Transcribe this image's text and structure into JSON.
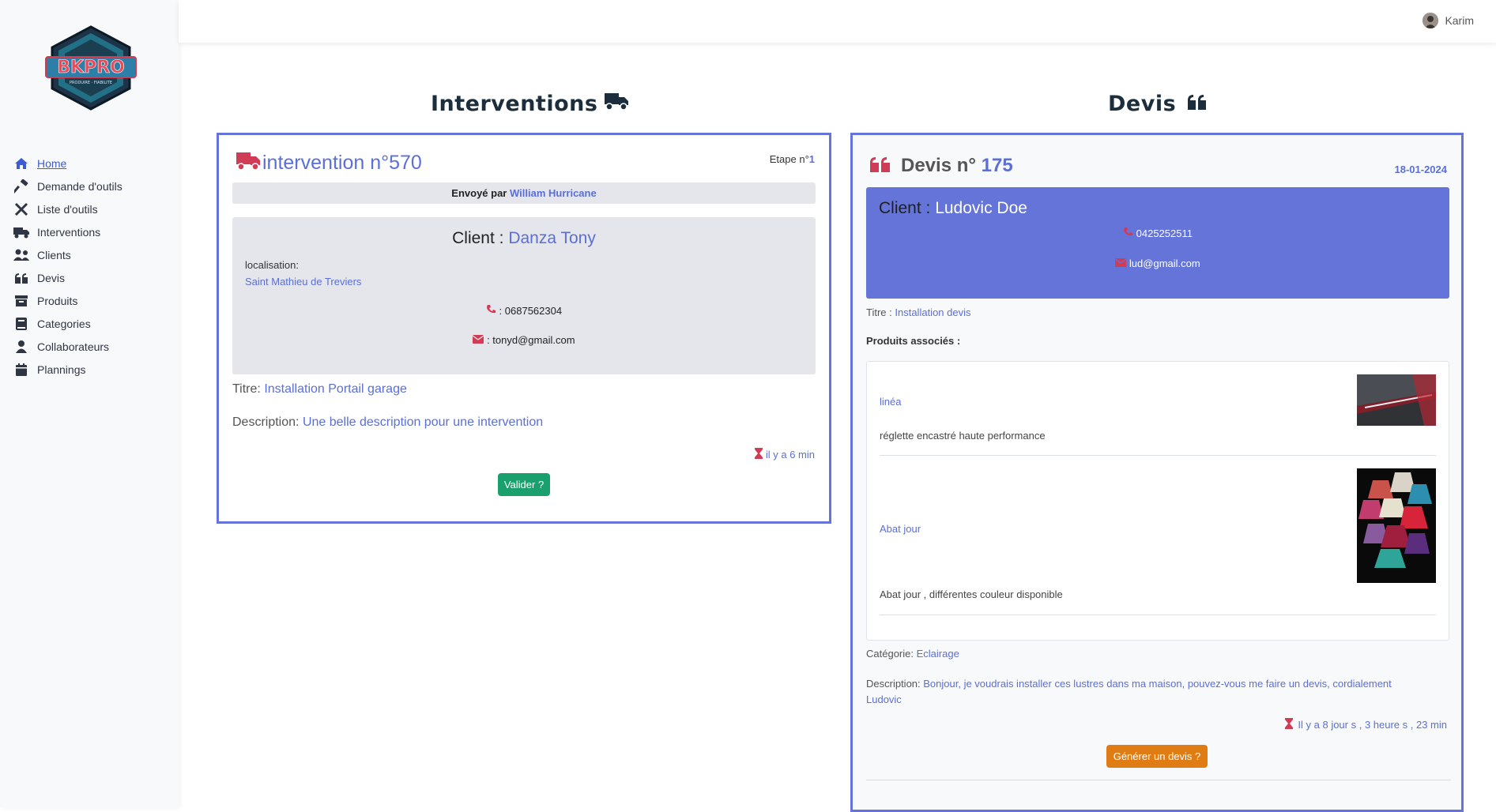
{
  "user": {
    "name": "Karim"
  },
  "brand": {
    "logo_text": "BKPRO",
    "logo_tagline": "PRODUIRE · FIABILITE"
  },
  "sidebar": {
    "items": [
      {
        "label": "Home",
        "icon": "home-icon"
      },
      {
        "label": "Demande d'outils",
        "icon": "hammer-icon"
      },
      {
        "label": "Liste d'outils",
        "icon": "tools-icon"
      },
      {
        "label": "Interventions",
        "icon": "truck-icon"
      },
      {
        "label": "Clients",
        "icon": "users-icon"
      },
      {
        "label": "Devis",
        "icon": "quote-icon"
      },
      {
        "label": "Produits",
        "icon": "box-icon"
      },
      {
        "label": "Categories",
        "icon": "book-icon"
      },
      {
        "label": "Collaborateurs",
        "icon": "user-icon"
      },
      {
        "label": "Plannings",
        "icon": "calendar-icon"
      }
    ]
  },
  "interventions": {
    "section_title": "Interventions",
    "title_prefix": "intervention n°",
    "number": "570",
    "etape_label": "Etape n°",
    "etape_value": "1",
    "sent_by_label": "Envoyé par",
    "sent_by": "William Hurricane",
    "client_label": "Client :",
    "client_name": "Danza Tony",
    "localisation_label": "localisation:",
    "localisation": "Saint Mathieu de Treviers",
    "phone": ": 0687562304",
    "email": ": tonyd@gmail.com",
    "titre_label": "Titre:",
    "titre": "Installation Portail garage",
    "description_label": "Description:",
    "description": "Une belle description pour une intervention",
    "time": "il y a 6 min",
    "validate_label": "Valider ?"
  },
  "devis": {
    "section_title": "Devis",
    "title_prefix": "Devis n°",
    "number": "175",
    "date": "18-01-2024",
    "client_label": "Client :",
    "client_name": "Ludovic Doe",
    "phone": "0425252511",
    "email": "lud@gmail.com",
    "titre_label": "Titre :",
    "titre": "Installation devis",
    "produits_label": "Produits associés :",
    "produits": [
      {
        "name": "linéa",
        "description": "réglette encastré haute performance"
      },
      {
        "name": "Abat jour",
        "description": "Abat jour , différentes couleur disponible"
      }
    ],
    "categorie_label": "Catégorie:",
    "categorie": "Eclairage",
    "description_label": "Description:",
    "description_line1": "Bonjour, je voudrais installer ces lustres dans ma maison, pouvez-vous me faire un devis, cordialement",
    "description_line2": "Ludovic",
    "time": "Il y a 8 jour s , 3 heure s , 23 min",
    "generate_label": "Générer un devis ?"
  },
  "colors": {
    "accent": "#6574d8",
    "red": "#d03b55",
    "green": "#1aa06d",
    "orange": "#e07c14",
    "client_panel": "#6574d8"
  }
}
